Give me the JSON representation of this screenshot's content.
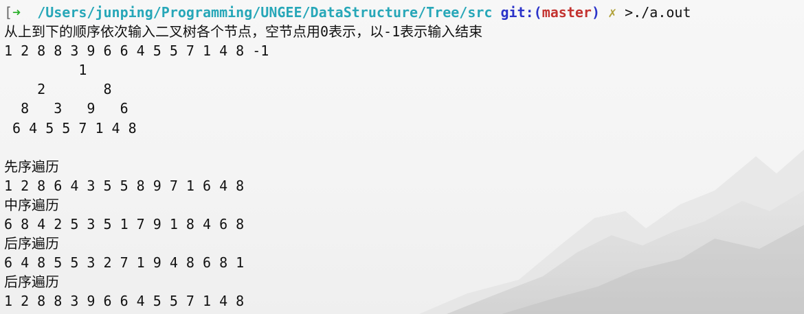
{
  "terminal": {
    "prompt": {
      "bracket": "[",
      "arrow": "➜",
      "path": "/Users/junping/Programming/UNGEE/DataStructure/Tree/src",
      "git_prefix": "git:(",
      "branch": "master",
      "git_suffix": ")",
      "dirty_mark": "✗",
      "command": ">./a.out"
    },
    "instruction": "从上到下的顺序依次输入二叉树各个节点，空节点用0表示，以-1表示输入结束",
    "input": "1 2 8 8 3 9 6 6 4 5 5 7 1 4 8 -1",
    "tree_lines": [
      "         1",
      "    2       8",
      "  8   3   9   6",
      " 6 4 5 5 7 1 4 8",
      ""
    ],
    "outputs": [
      {
        "label": "先序遍历",
        "values": "1 2 8 6 4 3 5 5 8 9 7 1 6 4 8"
      },
      {
        "label": "中序遍历",
        "values": "6 8 4 2 5 3 5 1 7 9 1 8 4 6 8"
      },
      {
        "label": "后序遍历",
        "values": "6 4 8 5 5 3 2 7 1 9 4 8 6 8 1"
      },
      {
        "label": "后序遍历",
        "values": "1 2 8 8 3 9 6 6 4 5 5 7 1 4 8"
      }
    ]
  },
  "colors": {
    "prompt_arrow": "#2fb12f",
    "prompt_path": "#27a7b8",
    "git_label": "#2b33c9",
    "git_branch": "#c3322f",
    "dirty_mark": "#b1a23b",
    "text": "#111111"
  }
}
